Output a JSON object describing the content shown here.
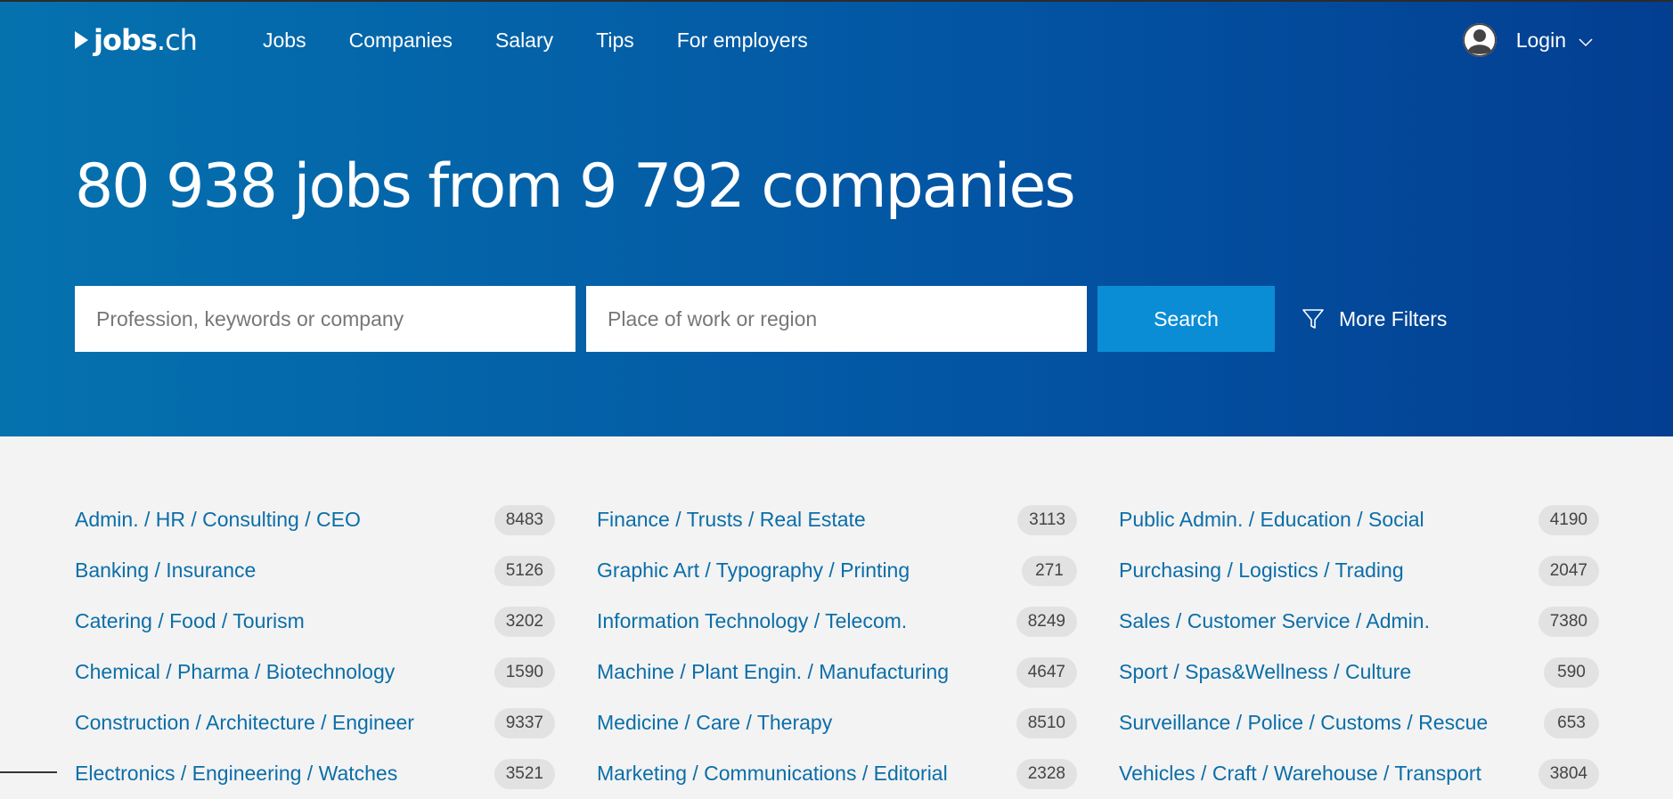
{
  "header": {
    "logo_word": "jobs",
    "logo_tld": ".ch",
    "nav": [
      "Jobs",
      "Companies",
      "Salary",
      "Tips",
      "For employers"
    ],
    "login_label": "Login"
  },
  "hero": {
    "headline": "80 938 jobs from 9 792 companies"
  },
  "search": {
    "keyword_placeholder": "Profession, keywords or company",
    "place_placeholder": "Place of work or region",
    "search_label": "Search",
    "filters_label": "More Filters"
  },
  "categories": [
    [
      {
        "label": "Admin. / HR / Consulting / CEO",
        "count": "8483"
      },
      {
        "label": "Banking / Insurance",
        "count": "5126"
      },
      {
        "label": "Catering / Food / Tourism",
        "count": "3202"
      },
      {
        "label": "Chemical / Pharma / Biotechnology",
        "count": "1590"
      },
      {
        "label": "Construction / Architecture / Engineer",
        "count": "9337"
      },
      {
        "label": "Electronics / Engineering / Watches",
        "count": "3521"
      }
    ],
    [
      {
        "label": "Finance / Trusts / Real Estate",
        "count": "3113"
      },
      {
        "label": "Graphic Art / Typography / Printing",
        "count": "271"
      },
      {
        "label": "Information Technology / Telecom.",
        "count": "8249"
      },
      {
        "label": "Machine / Plant Engin. / Manufacturing",
        "count": "4647"
      },
      {
        "label": "Medicine / Care / Therapy",
        "count": "8510"
      },
      {
        "label": "Marketing / Communications / Editorial",
        "count": "2328"
      }
    ],
    [
      {
        "label": "Public Admin. / Education / Social",
        "count": "4190"
      },
      {
        "label": "Purchasing / Logistics / Trading",
        "count": "2047"
      },
      {
        "label": "Sales / Customer Service / Admin.",
        "count": "7380"
      },
      {
        "label": "Sport / Spas&Wellness / Culture",
        "count": "590"
      },
      {
        "label": "Surveillance / Police / Customs / Rescue",
        "count": "653"
      },
      {
        "label": "Vehicles / Craft / Warehouse / Transport",
        "count": "3804"
      }
    ]
  ]
}
